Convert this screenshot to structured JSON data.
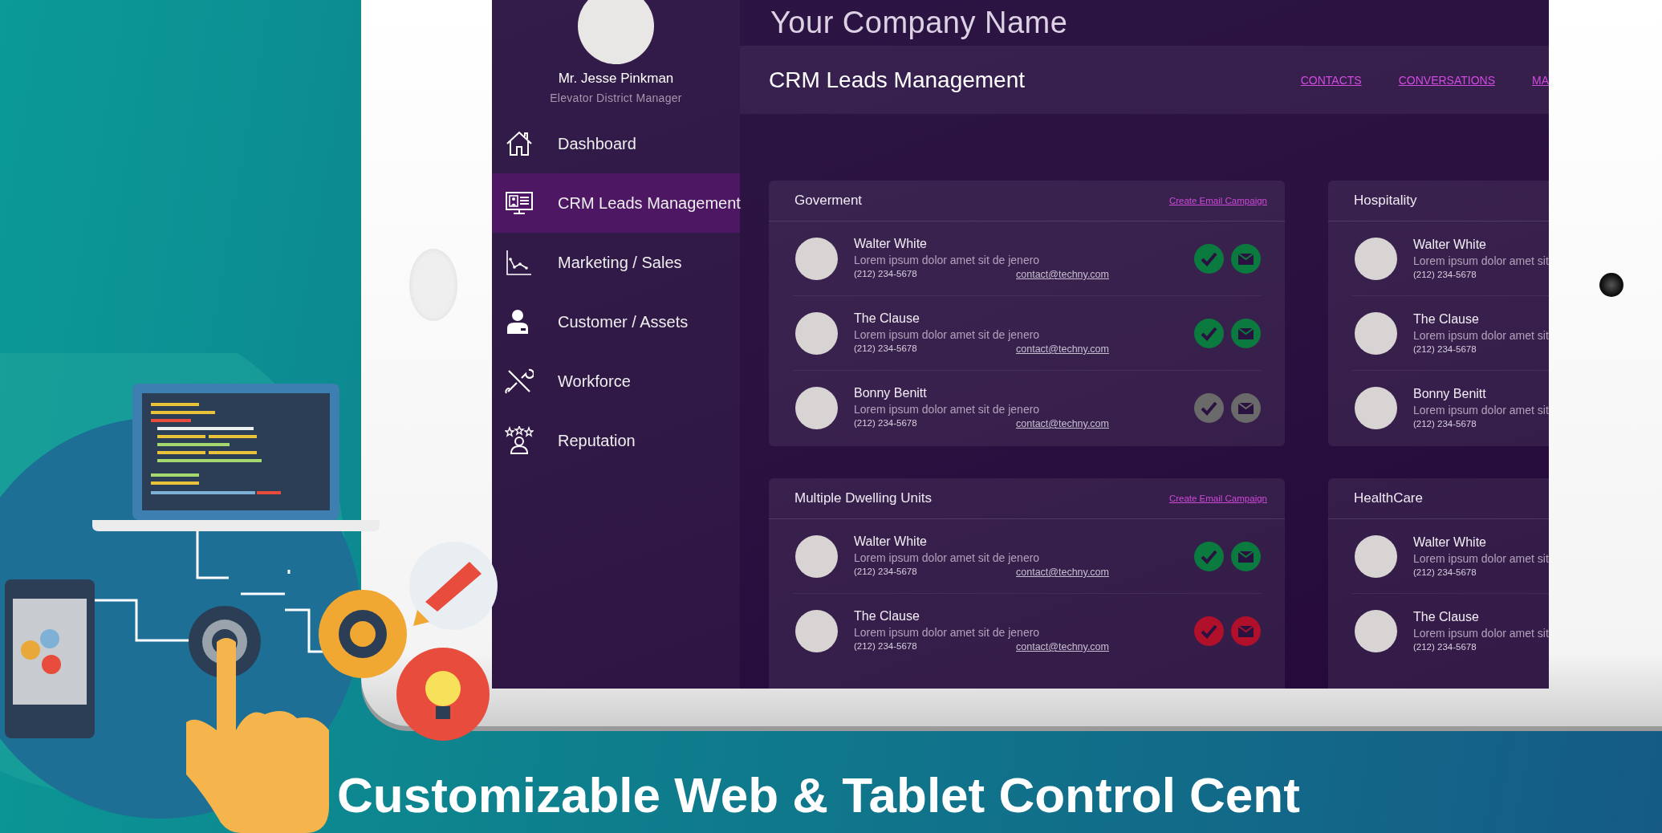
{
  "company_name": "Your Company Name",
  "profile": {
    "name": "Mr. Jesse Pinkman",
    "role": "Elevator District Manager"
  },
  "sidebar": {
    "items": [
      {
        "label": "Dashboard",
        "kind": "home",
        "selected": false
      },
      {
        "label": "CRM Leads Management",
        "kind": "crm",
        "selected": true
      },
      {
        "label": "Marketing / Sales",
        "kind": "chart",
        "selected": false
      },
      {
        "label": "Customer / Assets",
        "kind": "person",
        "selected": false
      },
      {
        "label": "Workforce",
        "kind": "tools",
        "selected": false
      },
      {
        "label": "Reputation",
        "kind": "stars",
        "selected": false
      }
    ]
  },
  "page_header": {
    "title": "CRM Leads Management",
    "links": [
      "CONTACTS",
      "CONVERSATIONS",
      "MA"
    ]
  },
  "groups": [
    {
      "title": "Goverment",
      "action": "Create Email Campaign",
      "contacts": [
        {
          "name": "Walter White",
          "note": "Lorem ipsum dolor amet sit de jenero",
          "phone": "(212) 234-5678",
          "email": "contact@techny.com",
          "color": "#0b7a3e"
        },
        {
          "name": "The Clause",
          "note": "Lorem ipsum dolor amet sit de jenero",
          "phone": "(212) 234-5678",
          "email": "contact@techny.com",
          "color": "#0b7a3e"
        },
        {
          "name": "Bonny Benitt",
          "note": "Lorem ipsum dolor amet sit de jenero",
          "phone": "(212) 234-5678",
          "email": "contact@techny.com",
          "color": "#6a6a6a"
        }
      ]
    },
    {
      "title": "Hospitality",
      "contacts": [
        {
          "name": "Walter White",
          "note": "Lorem ipsum dolor amet sit",
          "phone": "(212) 234-5678"
        },
        {
          "name": "The Clause",
          "note": "Lorem ipsum dolor amet sit",
          "phone": "(212) 234-5678"
        },
        {
          "name": "Bonny Benitt",
          "note": "Lorem ipsum dolor amet sit",
          "phone": "(212) 234-5678"
        }
      ]
    },
    {
      "title": "Multiple Dwelling Units",
      "action": "Create Email Campaign",
      "contacts": [
        {
          "name": "Walter White",
          "note": "Lorem ipsum dolor amet sit de jenero",
          "phone": "(212) 234-5678",
          "email": "contact@techny.com",
          "color": "#0b7a3e"
        },
        {
          "name": "The Clause",
          "note": "Lorem ipsum dolor amet sit de jenero",
          "phone": "(212) 234-5678",
          "email": "contact@techny.com",
          "color": "#b0102a"
        }
      ]
    },
    {
      "title": "HealthCare",
      "contacts": [
        {
          "name": "Walter White",
          "note": "Lorem ipsum dolor amet sit",
          "phone": "(212) 234-5678"
        },
        {
          "name": "The Clause",
          "note": "Lorem ipsum dolor amet sit",
          "phone": "(212) 234-5678"
        }
      ]
    }
  ],
  "headline": "Customizable Web & Tablet Control Cent"
}
